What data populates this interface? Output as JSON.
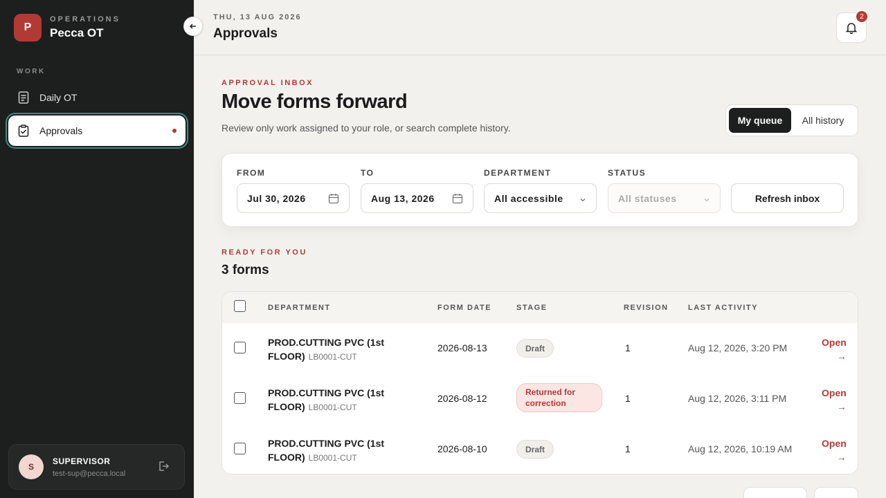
{
  "sidebar": {
    "brand": {
      "initial": "P",
      "eyebrow": "OPERATIONS",
      "name": "Pecca OT"
    },
    "section_label": "WORK",
    "items": [
      {
        "label": "Daily OT",
        "icon": "document-icon",
        "active": false
      },
      {
        "label": "Approvals",
        "icon": "clipboard-check-icon",
        "active": true,
        "has_dot": true
      }
    ],
    "user": {
      "initial": "S",
      "role": "SUPERVISOR",
      "email": "test-sup@pecca.local"
    }
  },
  "topbar": {
    "date": "THU, 13 AUG 2026",
    "title": "Approvals",
    "notification_count": "2"
  },
  "hero": {
    "eyebrow": "APPROVAL INBOX",
    "title": "Move forms forward",
    "subtitle": "Review only work assigned to your role, or search complete history."
  },
  "view_toggle": {
    "active": "My queue",
    "inactive": "All history"
  },
  "filters": {
    "from_label": "FROM",
    "from_value": "Jul 30, 2026",
    "to_label": "TO",
    "to_value": "Aug 13, 2026",
    "department_label": "DEPARTMENT",
    "department_value": "All accessible",
    "status_label": "STATUS",
    "status_value": "All statuses",
    "refresh_label": "Refresh inbox"
  },
  "results": {
    "eyebrow": "READY FOR YOU",
    "count": "3 forms"
  },
  "table": {
    "headers": {
      "department": "DEPARTMENT",
      "form_date": "FORM DATE",
      "stage": "STAGE",
      "revision": "REVISION",
      "last_activity": "LAST ACTIVITY"
    },
    "rows": [
      {
        "department": "PROD.CUTTING PVC (1st FLOOR)",
        "code": "LB0001-CUT",
        "form_date": "2026-08-13",
        "stage": "Draft",
        "revision": "1",
        "last_activity": "Aug 12, 2026, 3:20 PM",
        "action": "Open",
        "arrow": "→"
      },
      {
        "department": "PROD.CUTTING PVC (1st FLOOR)",
        "code": "LB0001-CUT",
        "form_date": "2026-08-12",
        "stage": "Returned for correction",
        "revision": "1",
        "last_activity": "Aug 12, 2026, 3:11 PM",
        "action": "Open",
        "arrow": "→"
      },
      {
        "department": "PROD.CUTTING PVC (1st FLOOR)",
        "code": "LB0001-CUT",
        "form_date": "2026-08-10",
        "stage": "Draft",
        "revision": "1",
        "last_activity": "Aug 12, 2026, 10:19 AM",
        "action": "Open",
        "arrow": "→"
      }
    ]
  },
  "colors": {
    "accent": "#b23a35",
    "sidebar_bg": "#1d1e1e",
    "page_bg": "#f3f1ee",
    "focus_ring": "#3f8a82"
  }
}
